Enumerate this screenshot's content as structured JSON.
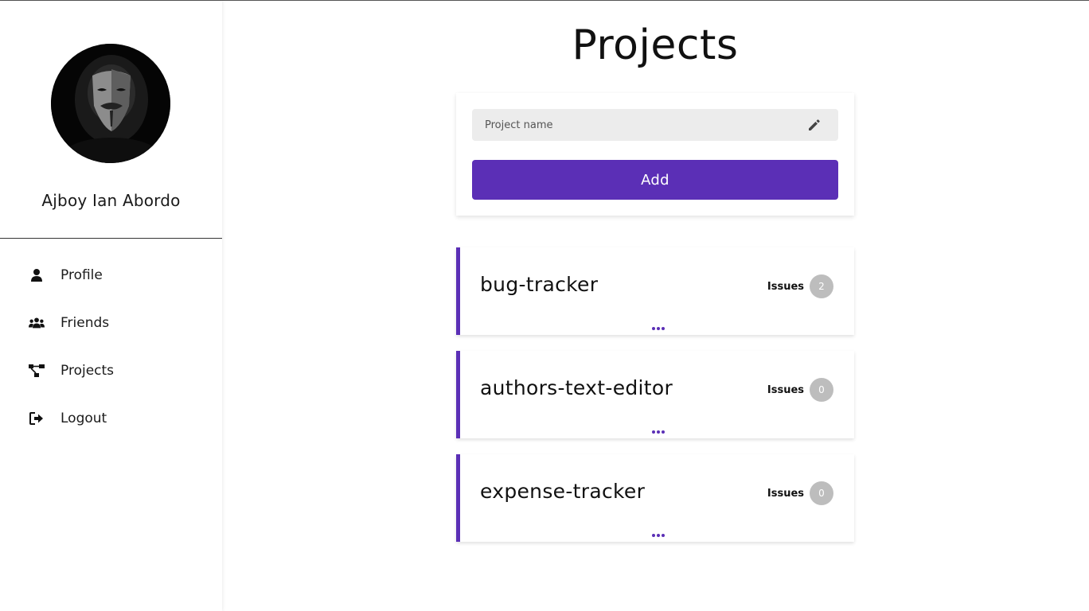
{
  "user": {
    "name": "Ajboy Ian Abordo"
  },
  "sidebar": {
    "items": [
      {
        "label": "Profile",
        "icon": "user-icon"
      },
      {
        "label": "Friends",
        "icon": "users-icon"
      },
      {
        "label": "Projects",
        "icon": "project-diagram-icon"
      },
      {
        "label": "Logout",
        "icon": "sign-out-icon"
      }
    ]
  },
  "main": {
    "title": "Projects",
    "new_project": {
      "placeholder": "Project name",
      "value": "",
      "add_label": "Add"
    },
    "projects": [
      {
        "name": "bug-tracker",
        "issues_label": "Issues",
        "issues_count": "2"
      },
      {
        "name": "authors-text-editor",
        "issues_label": "Issues",
        "issues_count": "0"
      },
      {
        "name": "expense-tracker",
        "issues_label": "Issues",
        "issues_count": "0"
      }
    ]
  },
  "colors": {
    "accent": "#5b2fb6",
    "badge": "#bdbdbd",
    "input_bg": "#ececec"
  }
}
